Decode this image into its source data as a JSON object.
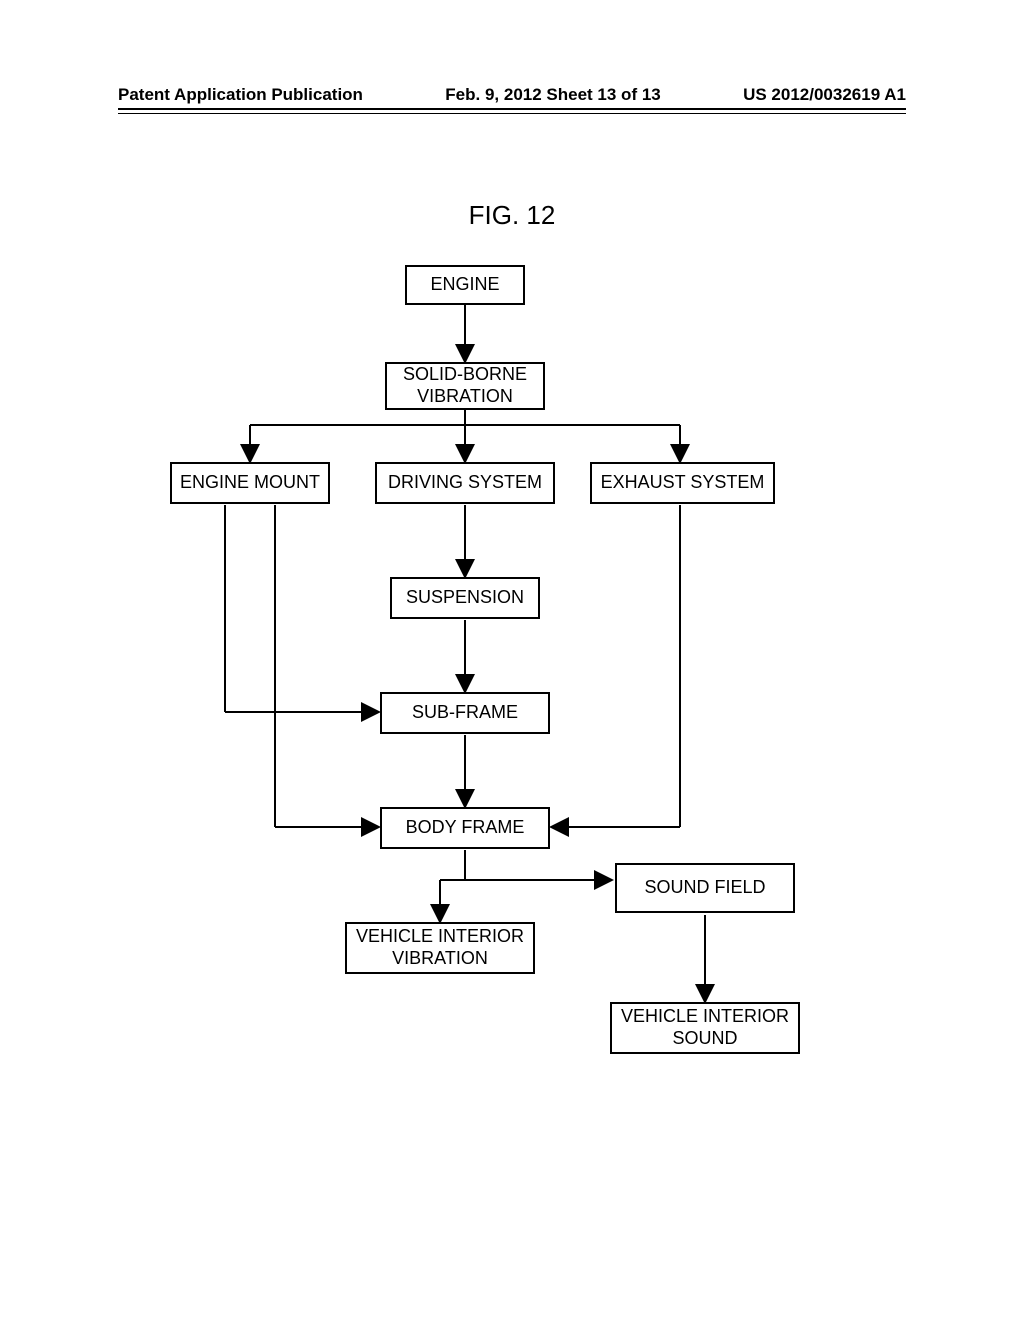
{
  "header": {
    "left": "Patent Application Publication",
    "center": "Feb. 9, 2012   Sheet 13 of 13",
    "right": "US 2012/0032619 A1"
  },
  "figure": {
    "title": "FIG. 12"
  },
  "boxes": {
    "engine": "ENGINE",
    "solidBorne": "SOLID-BORNE\nVIBRATION",
    "engineMount": "ENGINE MOUNT",
    "drivingSystem": "DRIVING SYSTEM",
    "exhaustSystem": "EXHAUST SYSTEM",
    "suspension": "SUSPENSION",
    "subFrame": "SUB-FRAME",
    "bodyFrame": "BODY FRAME",
    "vehicleInteriorVibration": "VEHICLE INTERIOR\nVIBRATION",
    "soundField": "SOUND FIELD",
    "vehicleInteriorSound": "VEHICLE INTERIOR\nSOUND"
  },
  "chart_data": {
    "type": "flowchart",
    "title": "FIG. 12",
    "nodes": [
      {
        "id": "engine",
        "label": "ENGINE"
      },
      {
        "id": "solidBorne",
        "label": "SOLID-BORNE VIBRATION"
      },
      {
        "id": "engineMount",
        "label": "ENGINE MOUNT"
      },
      {
        "id": "drivingSystem",
        "label": "DRIVING SYSTEM"
      },
      {
        "id": "exhaustSystem",
        "label": "EXHAUST SYSTEM"
      },
      {
        "id": "suspension",
        "label": "SUSPENSION"
      },
      {
        "id": "subFrame",
        "label": "SUB-FRAME"
      },
      {
        "id": "bodyFrame",
        "label": "BODY FRAME"
      },
      {
        "id": "vehicleInteriorVibration",
        "label": "VEHICLE INTERIOR VIBRATION"
      },
      {
        "id": "soundField",
        "label": "SOUND FIELD"
      },
      {
        "id": "vehicleInteriorSound",
        "label": "VEHICLE INTERIOR SOUND"
      }
    ],
    "edges": [
      {
        "from": "engine",
        "to": "solidBorne"
      },
      {
        "from": "solidBorne",
        "to": "engineMount"
      },
      {
        "from": "solidBorne",
        "to": "drivingSystem"
      },
      {
        "from": "solidBorne",
        "to": "exhaustSystem"
      },
      {
        "from": "drivingSystem",
        "to": "suspension"
      },
      {
        "from": "suspension",
        "to": "subFrame"
      },
      {
        "from": "engineMount",
        "to": "subFrame"
      },
      {
        "from": "subFrame",
        "to": "bodyFrame"
      },
      {
        "from": "engineMount",
        "to": "bodyFrame"
      },
      {
        "from": "exhaustSystem",
        "to": "bodyFrame"
      },
      {
        "from": "bodyFrame",
        "to": "vehicleInteriorVibration"
      },
      {
        "from": "bodyFrame",
        "to": "soundField"
      },
      {
        "from": "soundField",
        "to": "vehicleInteriorSound"
      }
    ]
  }
}
